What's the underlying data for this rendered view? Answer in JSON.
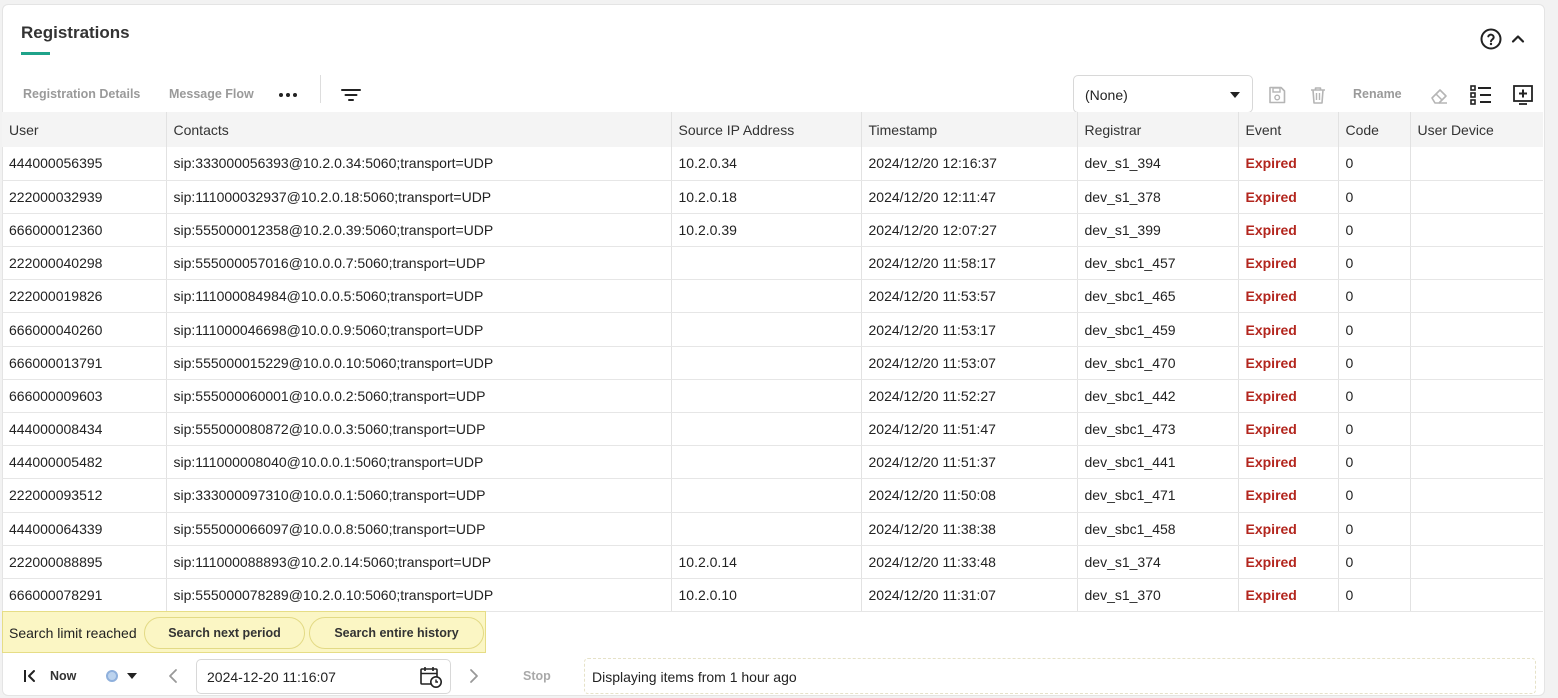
{
  "header": {
    "title": "Registrations"
  },
  "toolbar": {
    "registration_details": "Registration Details",
    "message_flow": "Message Flow",
    "view_select_value": "(None)",
    "rename": "Rename"
  },
  "table": {
    "columns": [
      "User",
      "Contacts",
      "Source IP Address",
      "Timestamp",
      "Registrar",
      "Event",
      "Code",
      "User Device"
    ],
    "rows": [
      [
        "444000056395",
        "sip:333000056393@10.2.0.34:5060;transport=UDP",
        "10.2.0.34",
        "2024/12/20 12:16:37",
        "dev_s1_394",
        "Expired",
        "0",
        ""
      ],
      [
        "222000032939",
        "sip:111000032937@10.2.0.18:5060;transport=UDP",
        "10.2.0.18",
        "2024/12/20 12:11:47",
        "dev_s1_378",
        "Expired",
        "0",
        ""
      ],
      [
        "666000012360",
        "sip:555000012358@10.2.0.39:5060;transport=UDP",
        "10.2.0.39",
        "2024/12/20 12:07:27",
        "dev_s1_399",
        "Expired",
        "0",
        ""
      ],
      [
        "222000040298",
        "sip:555000057016@10.0.0.7:5060;transport=UDP",
        "",
        "2024/12/20 11:58:17",
        "dev_sbc1_457",
        "Expired",
        "0",
        ""
      ],
      [
        "222000019826",
        "sip:111000084984@10.0.0.5:5060;transport=UDP",
        "",
        "2024/12/20 11:53:57",
        "dev_sbc1_465",
        "Expired",
        "0",
        ""
      ],
      [
        "666000040260",
        "sip:111000046698@10.0.0.9:5060;transport=UDP",
        "",
        "2024/12/20 11:53:17",
        "dev_sbc1_459",
        "Expired",
        "0",
        ""
      ],
      [
        "666000013791",
        "sip:555000015229@10.0.0.10:5060;transport=UDP",
        "",
        "2024/12/20 11:53:07",
        "dev_sbc1_470",
        "Expired",
        "0",
        ""
      ],
      [
        "666000009603",
        "sip:555000060001@10.0.0.2:5060;transport=UDP",
        "",
        "2024/12/20 11:52:27",
        "dev_sbc1_442",
        "Expired",
        "0",
        ""
      ],
      [
        "444000008434",
        "sip:555000080872@10.0.0.3:5060;transport=UDP",
        "",
        "2024/12/20 11:51:47",
        "dev_sbc1_473",
        "Expired",
        "0",
        ""
      ],
      [
        "444000005482",
        "sip:111000008040@10.0.0.1:5060;transport=UDP",
        "",
        "2024/12/20 11:51:37",
        "dev_sbc1_441",
        "Expired",
        "0",
        ""
      ],
      [
        "222000093512",
        "sip:333000097310@10.0.0.1:5060;transport=UDP",
        "",
        "2024/12/20 11:50:08",
        "dev_sbc1_471",
        "Expired",
        "0",
        ""
      ],
      [
        "444000064339",
        "sip:555000066097@10.0.0.8:5060;transport=UDP",
        "",
        "2024/12/20 11:38:38",
        "dev_sbc1_458",
        "Expired",
        "0",
        ""
      ],
      [
        "222000088895",
        "sip:111000088893@10.2.0.14:5060;transport=UDP",
        "10.2.0.14",
        "2024/12/20 11:33:48",
        "dev_s1_374",
        "Expired",
        "0",
        ""
      ],
      [
        "666000078291",
        "sip:555000078289@10.2.0.10:5060;transport=UDP",
        "10.2.0.10",
        "2024/12/20 11:31:07",
        "dev_s1_370",
        "Expired",
        "0",
        ""
      ]
    ]
  },
  "search_limit": {
    "message": "Search limit reached",
    "next_period": "Search next period",
    "entire_history": "Search entire history"
  },
  "footer": {
    "now": "Now",
    "date_value": "2024-12-20 11:16:07",
    "stop": "Stop",
    "status": "Displaying items from 1 hour ago"
  },
  "colors": {
    "accent": "#1fa38a",
    "event_expired": "#b3261e",
    "limit_background": "#fbf6c4"
  }
}
